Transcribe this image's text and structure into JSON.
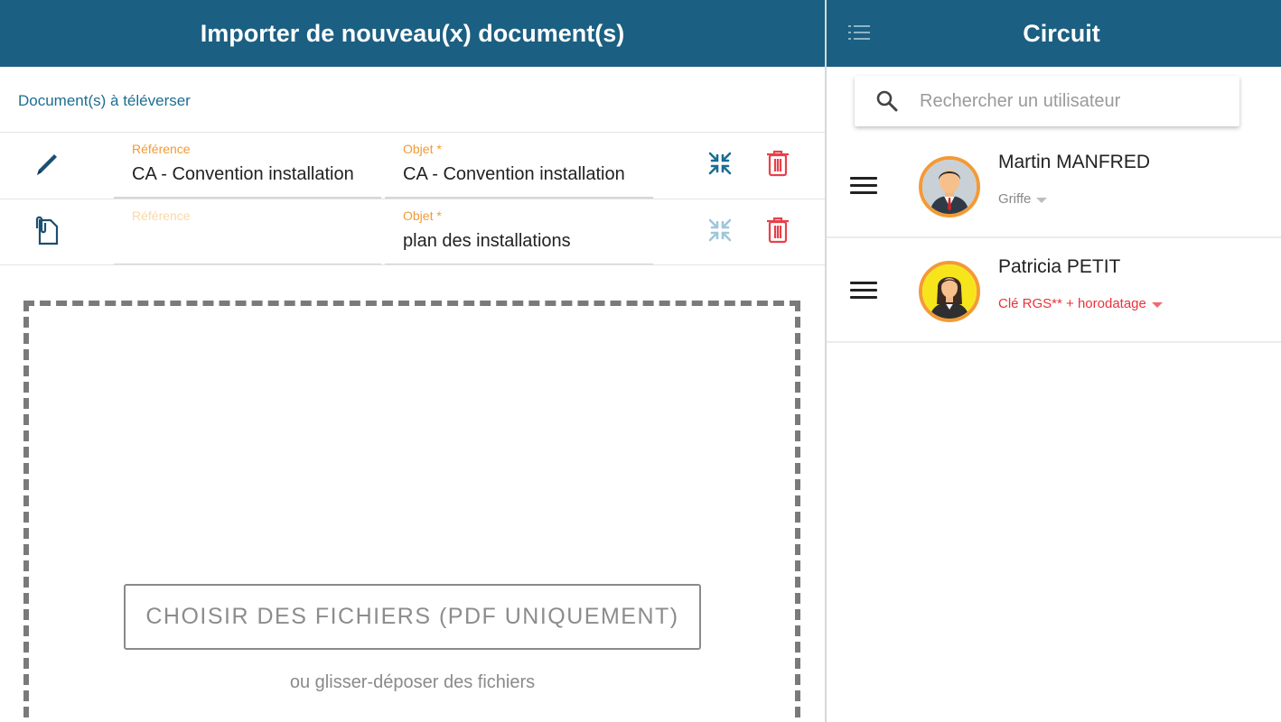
{
  "left_panel": {
    "header_title": "Importer de nouveau(x) document(s)",
    "section_label": "Document(s) à téléverser",
    "documents": [
      {
        "type_icon": "pencil-icon",
        "reference_label": "Référence",
        "reference_value": "CA - Convention installation",
        "object_label": "Objet *",
        "object_value": "CA - Convention installation"
      },
      {
        "type_icon": "paperclip-document-icon",
        "reference_label": "Référence",
        "reference_value": "",
        "object_label": "Objet *",
        "object_value": "plan des installations"
      }
    ],
    "choose_files_label": "CHOISIR DES FICHIERS (PDF UNIQUEMENT)",
    "drop_hint": "ou glisser-déposer des fichiers"
  },
  "right_panel": {
    "header_title": "Circuit",
    "search": {
      "placeholder": "Rechercher un utilisateur",
      "value": ""
    },
    "users": [
      {
        "name": "Martin MANFRED",
        "role": "Griffe",
        "avatar": "man-avatar"
      },
      {
        "name": "Patricia PETIT",
        "role": "Clé RGS** + horodatage",
        "avatar": "woman-avatar"
      }
    ]
  },
  "colors": {
    "header_bg": "#1b5f82",
    "accent_orange": "#f39a36",
    "delete_red": "#e8404a",
    "link_blue": "#1b6e93",
    "role_red": "#e8323a"
  }
}
